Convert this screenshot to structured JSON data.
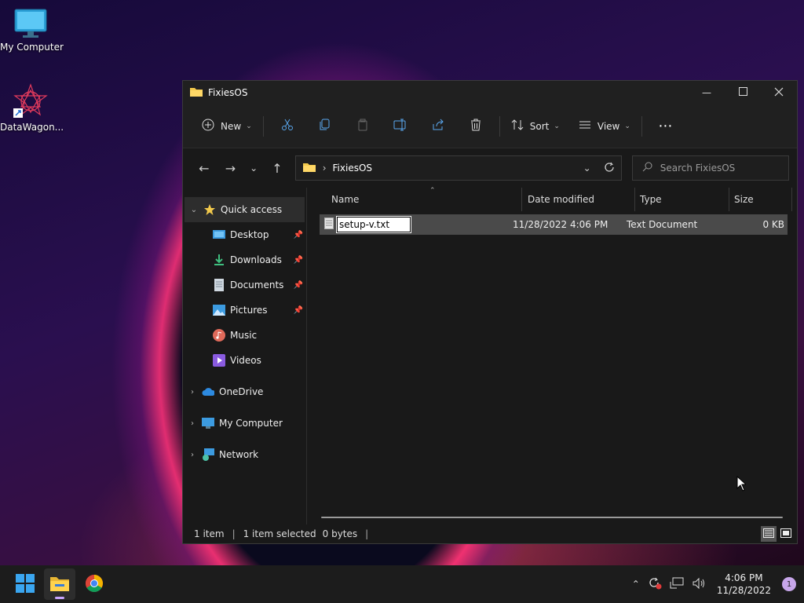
{
  "desktop": {
    "icons": [
      {
        "label": "My Computer",
        "icon": "monitor-icon"
      },
      {
        "label": "DataWagon...",
        "icon": "datawagon-shortcut-icon"
      }
    ]
  },
  "window": {
    "title": "FixiesOS",
    "toolbar": {
      "new_label": "New",
      "sort_label": "Sort",
      "view_label": "View"
    },
    "address": {
      "folder": "FixiesOS"
    },
    "search": {
      "placeholder": "Search FixiesOS"
    },
    "sidebar": {
      "quick_access": "Quick access",
      "items": [
        {
          "label": "Desktop",
          "icon": "desktop-folder-icon",
          "pinned": true
        },
        {
          "label": "Downloads",
          "icon": "downloads-icon",
          "pinned": true
        },
        {
          "label": "Documents",
          "icon": "documents-icon",
          "pinned": true
        },
        {
          "label": "Pictures",
          "icon": "pictures-icon",
          "pinned": true
        },
        {
          "label": "Music",
          "icon": "music-icon",
          "pinned": false
        },
        {
          "label": "Videos",
          "icon": "videos-icon",
          "pinned": false
        }
      ],
      "onedrive": "OneDrive",
      "my_computer": "My Computer",
      "network": "Network"
    },
    "columns": {
      "name": "Name",
      "date": "Date modified",
      "type": "Type",
      "size": "Size"
    },
    "files": [
      {
        "name": "setup-v.txt",
        "date": "11/28/2022 4:06 PM",
        "type": "Text Document",
        "size": "0 KB"
      }
    ],
    "status": {
      "count": "1 item",
      "selected": "1 item selected",
      "bytes": "0 bytes"
    }
  },
  "taskbar": {
    "clock_time": "4:06 PM",
    "clock_date": "11/28/2022",
    "notification_count": "1"
  }
}
